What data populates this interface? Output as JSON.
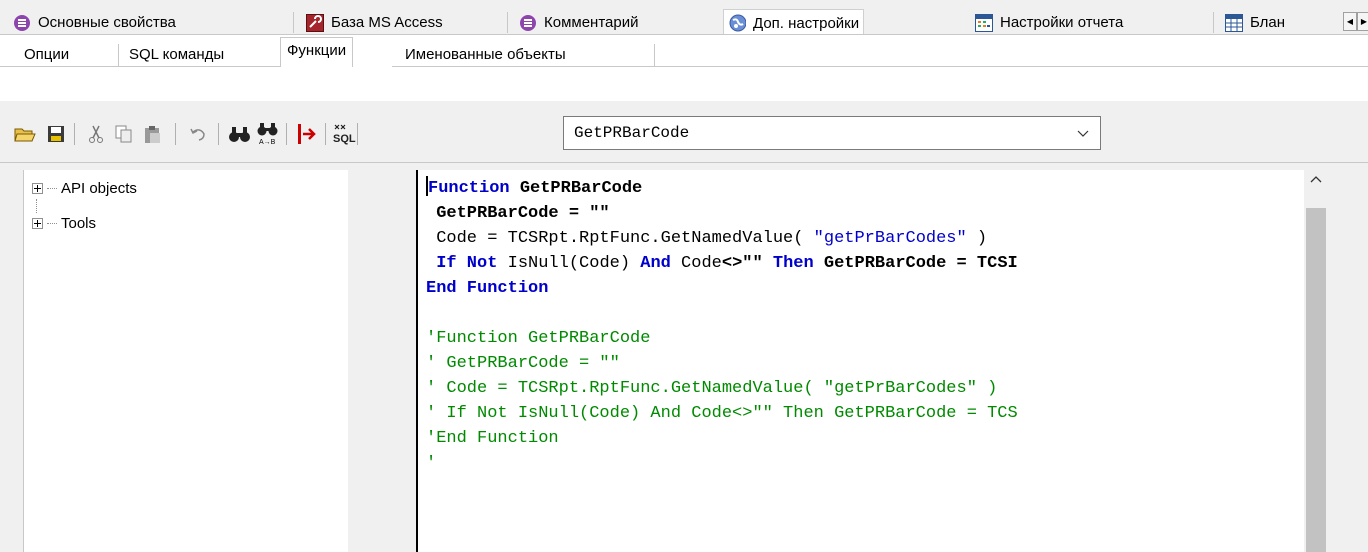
{
  "top_tabs": [
    {
      "label": "Основные свойства",
      "icon": "database-circle-icon"
    },
    {
      "label": "База MS Access",
      "icon": "access-key-icon"
    },
    {
      "label": "Комментарий",
      "icon": "comment-circle-icon"
    },
    {
      "label": "Доп. настройки",
      "icon": "globe-icon",
      "active": true
    },
    {
      "label": "Настройки отчета",
      "icon": "report-settings-icon"
    },
    {
      "label": "Блан",
      "icon": "form-grid-icon"
    }
  ],
  "sub_tabs": [
    {
      "label": "Опции"
    },
    {
      "label": "SQL команды"
    },
    {
      "label": "Функции",
      "active": true
    },
    {
      "label": "Именованные объекты"
    }
  ],
  "toolbar": {
    "combo_value": "GetPRBarCode",
    "icons": [
      "open-folder-icon",
      "save-disk-icon",
      "cut-icon",
      "copy-icon",
      "paste-icon",
      "undo-icon",
      "find-icon",
      "replace-icon",
      "goto-icon",
      "sql-icon"
    ]
  },
  "tree": {
    "items": [
      {
        "label": "API objects"
      },
      {
        "label": "Tools"
      }
    ]
  },
  "editor": {
    "lines": [
      {
        "parts": [
          {
            "c": "kw",
            "t": "Function"
          },
          {
            "c": "bd",
            "t": " GetPRBarCode"
          }
        ]
      },
      {
        "parts": [
          {
            "c": "bd",
            "t": " GetPRBarCode = \"\""
          }
        ]
      },
      {
        "parts": [
          {
            "c": "",
            "t": " Code = TCSRpt.RptFunc.GetNamedValue( "
          },
          {
            "c": "str",
            "t": "\"getPrBarCodes\""
          },
          {
            "c": "",
            "t": " )"
          }
        ]
      },
      {
        "parts": [
          {
            "c": "kw",
            "t": " If Not"
          },
          {
            "c": "",
            "t": " IsNull(Code) "
          },
          {
            "c": "kw",
            "t": "And"
          },
          {
            "c": "",
            "t": " Code"
          },
          {
            "c": "bd",
            "t": "<>\"\""
          },
          {
            "c": "",
            "t": " "
          },
          {
            "c": "kw",
            "t": "Then"
          },
          {
            "c": "bd",
            "t": " GetPRBarCode = TCSI"
          }
        ]
      },
      {
        "parts": [
          {
            "c": "kw",
            "t": "End Function"
          }
        ]
      },
      {
        "parts": [
          {
            "c": "",
            "t": ""
          }
        ]
      },
      {
        "parts": [
          {
            "c": "cm",
            "t": "'Function GetPRBarCode"
          }
        ]
      },
      {
        "parts": [
          {
            "c": "cm",
            "t": "' GetPRBarCode = \"\""
          }
        ]
      },
      {
        "parts": [
          {
            "c": "cm",
            "t": "' Code = TCSRpt.RptFunc.GetNamedValue( \"getPrBarCodes\" )"
          }
        ]
      },
      {
        "parts": [
          {
            "c": "cm",
            "t": "' If Not IsNull(Code) And Code<>\"\" Then GetPRBarCode = TCS"
          }
        ]
      },
      {
        "parts": [
          {
            "c": "cm",
            "t": "'End Function"
          }
        ]
      },
      {
        "parts": [
          {
            "c": "cm",
            "t": "'"
          }
        ]
      }
    ]
  }
}
